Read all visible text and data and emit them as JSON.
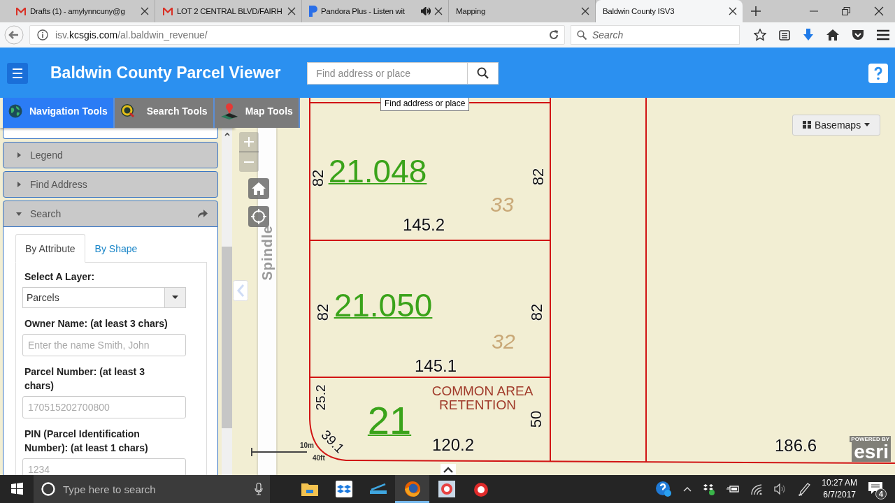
{
  "browser": {
    "tabs": [
      {
        "title": "Drafts (1) - amylynncuny@g",
        "kind": "mail",
        "audio": false,
        "selected": false
      },
      {
        "title": "LOT 2 CENTRAL BLVD/FAIRH",
        "kind": "mail",
        "audio": false,
        "selected": false
      },
      {
        "title": "Pandora Plus - Listen wit",
        "kind": "pandora",
        "audio": true,
        "selected": false
      },
      {
        "title": "Mapping",
        "kind": "plain",
        "audio": false,
        "selected": false
      },
      {
        "title": "Baldwin County ISV3",
        "kind": "plain",
        "audio": false,
        "selected": true
      }
    ],
    "url": {
      "prefix": "isv.",
      "domain": "kcsgis.com",
      "path": "/al.baldwin_revenue/"
    },
    "search": {
      "placeholder": "Search"
    }
  },
  "app": {
    "title": "Baldwin County Parcel Viewer",
    "search": {
      "placeholder": "Find address or place"
    },
    "tooltip": "Find address or place"
  },
  "tool_tabs": [
    {
      "label": "Navigation Tools",
      "kind": "navigation",
      "selected": true
    },
    {
      "label": "Search Tools",
      "kind": "search",
      "selected": false
    },
    {
      "label": "Map Tools",
      "kind": "map",
      "selected": false
    }
  ],
  "panels": [
    {
      "label": "Legend",
      "expanded": false
    },
    {
      "label": "Find Address",
      "expanded": false
    },
    {
      "label": "Search",
      "expanded": true
    }
  ],
  "search_tabs": [
    {
      "label": "By Attribute",
      "selected": true
    },
    {
      "label": "By Shape",
      "selected": false
    }
  ],
  "form": {
    "layer": {
      "label": "Select A Layer:",
      "value": "Parcels"
    },
    "fields": [
      {
        "label": "Owner Name: (at least 3 chars)",
        "placeholder": "Enter the name Smith, John"
      },
      {
        "label": "Parcel Number: (at least 3 chars)",
        "placeholder": "170515202700800"
      },
      {
        "label": "PIN (Parcel Identification Number): (at least 1 chars)",
        "placeholder": "1234"
      }
    ]
  },
  "map": {
    "basemaps": "Basemaps",
    "street": "Spindle",
    "labels": [
      {
        "kind": "parcel",
        "text": "21.048"
      },
      {
        "kind": "dimension",
        "text": "82"
      },
      {
        "kind": "lot",
        "text": "33"
      },
      {
        "kind": "dimension",
        "text": "82"
      },
      {
        "kind": "dimension",
        "text": "145.2"
      },
      {
        "kind": "dimension",
        "text": "82"
      },
      {
        "kind": "parcel",
        "text": "21.050"
      },
      {
        "kind": "dimension",
        "text": "82"
      },
      {
        "kind": "lot",
        "text": "32"
      },
      {
        "kind": "dimension",
        "text": "145.1"
      },
      {
        "kind": "dimension",
        "text": "25.2"
      },
      {
        "kind": "area",
        "text": "COMMON AREA"
      },
      {
        "kind": "area",
        "text": "RETENTION"
      },
      {
        "kind": "dimension",
        "text": "50"
      },
      {
        "kind": "parcel",
        "text": "21"
      },
      {
        "kind": "dimension",
        "text": "39.1"
      },
      {
        "kind": "dimension",
        "text": "120.2"
      },
      {
        "kind": "dimension",
        "text": "186.6"
      }
    ],
    "scale": {
      "metric": "10m",
      "imperial": "40ft"
    },
    "attribution": {
      "top": "POWERED BY",
      "logo": "esri"
    }
  },
  "taskbar": {
    "search_placeholder": "Type here to search",
    "apps": [
      {
        "kind": "folder",
        "active": false
      },
      {
        "kind": "dropbox",
        "active": false
      },
      {
        "kind": "scanner",
        "active": false
      },
      {
        "kind": "firefox",
        "active": true
      },
      {
        "kind": "e-box",
        "active": false
      },
      {
        "kind": "e-round",
        "active": false
      }
    ],
    "time": "10:27 AM",
    "date": "6/7/2017",
    "notifications": "4"
  }
}
